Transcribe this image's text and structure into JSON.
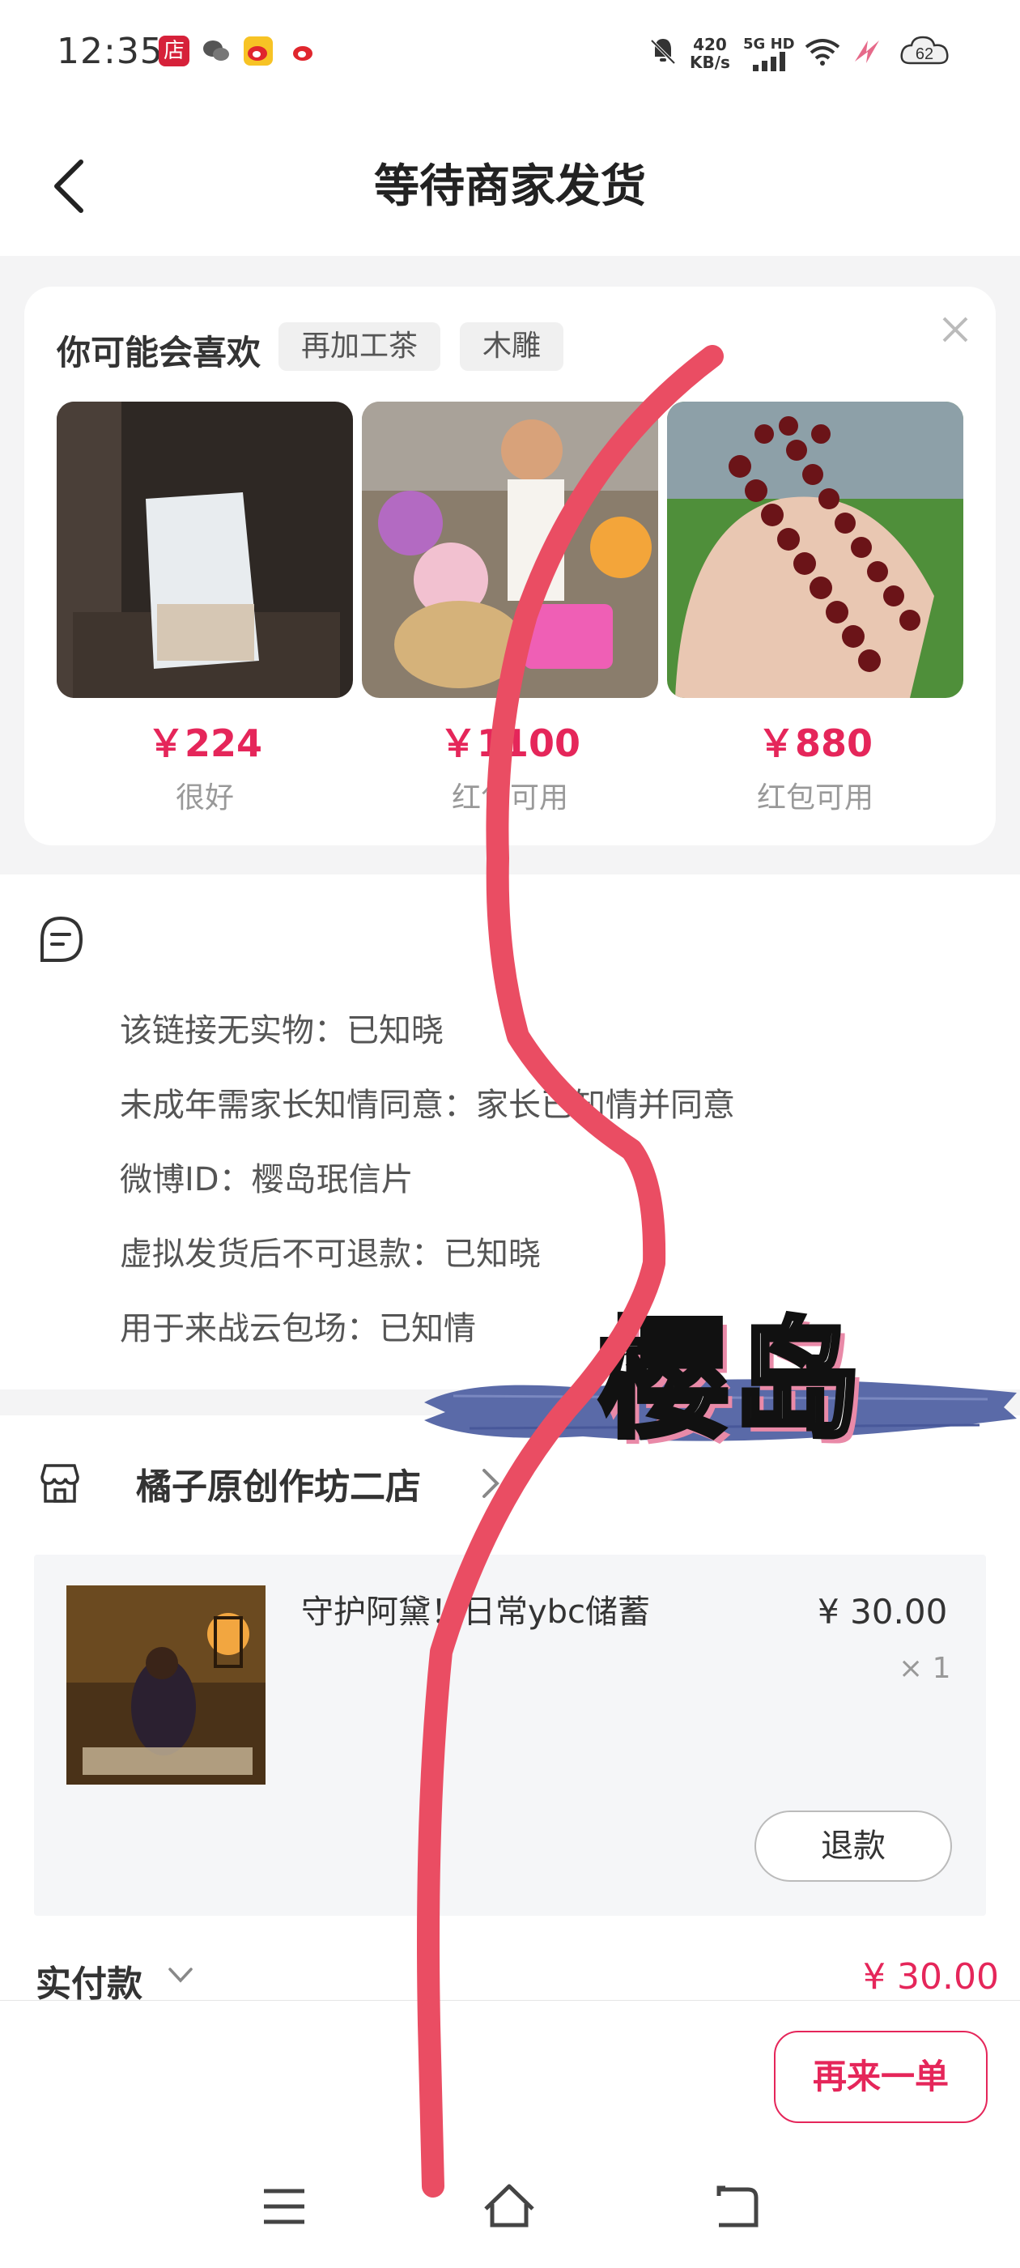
{
  "status_bar": {
    "time": "12:35",
    "net_speed_value": "420",
    "net_speed_unit": "KB/s",
    "network": "5G HD",
    "battery": "62"
  },
  "header": {
    "title": "等待商家发货"
  },
  "recommend": {
    "title": "你可能会喜欢",
    "tags": [
      "再加工茶",
      "木雕"
    ],
    "products": [
      {
        "price": "￥224",
        "label": "很好"
      },
      {
        "price": "￥1100",
        "label": "红包可用"
      },
      {
        "price": "￥880",
        "label": "红包可用"
      }
    ]
  },
  "info": {
    "lines": [
      "该链接无实物：已知晓",
      "未成年需家长知情同意：家长已知情并同意",
      "微博ID：樱岛珉信片",
      "虚拟发货后不可退款：已知晓",
      "用于来战云包场：已知情"
    ]
  },
  "shop": {
    "name": "橘子原创作坊二店",
    "item": {
      "name": "守护阿黛！日常ybc储蓄",
      "price": "¥ 30.00",
      "qty": "× 1"
    },
    "refund_label": "退款",
    "paid_label": "实付款",
    "paid_value": "¥ 30.00"
  },
  "bottom": {
    "reorder_label": "再来一单"
  },
  "watermark": {
    "text": "樱岛"
  },
  "colors": {
    "accent": "#e5265a",
    "scribble": "#ea4d63",
    "brush": "#5a6aa8"
  }
}
